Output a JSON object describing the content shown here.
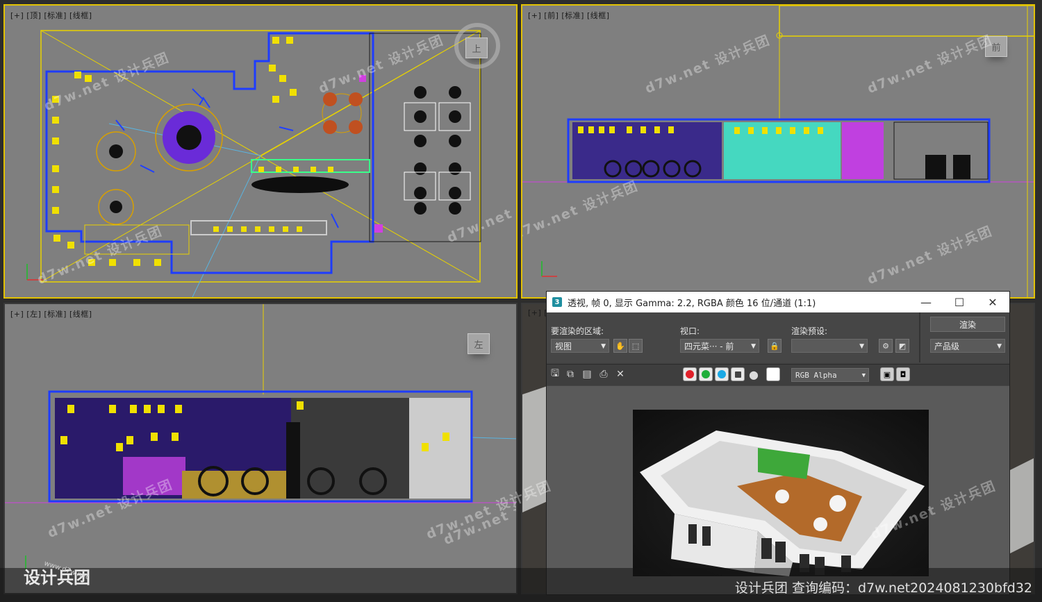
{
  "viewports": {
    "top": {
      "label": "[+] [顶] [标准] [线框]",
      "cube": "上"
    },
    "front": {
      "label": "[+] [前] [标准] [线框]",
      "cube": "前"
    },
    "left": {
      "label": "[+] [左] [标准] [线框]",
      "cube": "左"
    },
    "persp": {
      "label": "[+] ["
    }
  },
  "axis": {
    "x": "x",
    "y": "y",
    "z": "z"
  },
  "render_window": {
    "title": "透视, 帧 0, 显示 Gamma: 2.2, RGBA 颜色 16 位/通道 (1:1)",
    "app_icon": "3",
    "minimize": "—",
    "maximize": "☐",
    "close": "✕",
    "area_label": "要渲染的区域:",
    "area_value": "视图",
    "viewport_label": "视口:",
    "viewport_value": "四元菜··· - 前",
    "preset_label": "渲染预设:",
    "preset_value": "",
    "render_button": "渲染",
    "quality_value": "产品级",
    "channel_value": "RGB Alpha",
    "channels": [
      {
        "name": "red",
        "color": "#e0202a"
      },
      {
        "name": "green",
        "color": "#1fae3a"
      },
      {
        "name": "blue",
        "color": "#1aa9e6"
      }
    ]
  },
  "watermarks": [
    "d7w.net 设计兵团"
  ],
  "bottom_bar": {
    "text": "设计兵团  查询编码：d7w.net2024081230bfd32",
    "logo": "设计兵团",
    "logo_url": "www.d7w.net"
  }
}
